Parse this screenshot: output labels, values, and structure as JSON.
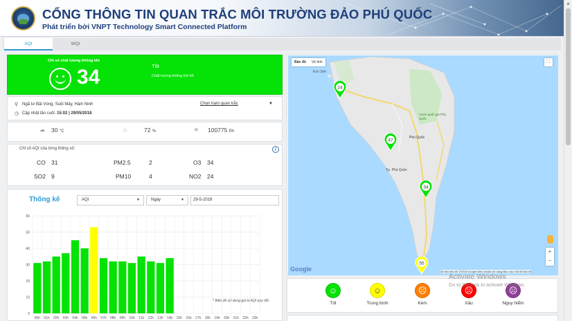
{
  "header": {
    "title": "CỔNG THÔNG TIN QUAN TRẮC MÔI TRƯỜNG ĐẢO PHÚ QUỐC",
    "subtitle": "Phát triển bởi VNPT Technology Smart Connected Platform"
  },
  "tabs": [
    {
      "label": "AQI"
    },
    {
      "label": "WQI"
    }
  ],
  "aqi": {
    "label": "Chỉ số chất lượng không khí",
    "value": "34",
    "status": "Tốt",
    "description": "Chất lượng không khí tốt",
    "color": "#05e205"
  },
  "location": {
    "address": "Ngã tư Bãi Vòng, Suối Mây, Hàm Ninh",
    "updated_label": "Cập nhật lần cuối:",
    "updated_value": "15:02 | 29/05/2018",
    "select_station": "Chọn trạm quan trắc"
  },
  "weather": {
    "temperature": "30",
    "temperature_unit": "°C",
    "humidity": "72",
    "humidity_unit": "%",
    "pressure": "100775",
    "pressure_unit": "PA"
  },
  "components": {
    "title": "Chỉ số AQI của từng thông số:",
    "items": [
      {
        "name": "CO",
        "value": "31"
      },
      {
        "name": "PM2.5",
        "value": "2"
      },
      {
        "name": "O3",
        "value": "34"
      },
      {
        "name": "SO2",
        "value": "9"
      },
      {
        "name": "PM10",
        "value": "4"
      },
      {
        "name": "NO2",
        "value": "24"
      }
    ]
  },
  "stats": {
    "title": "Thống kê",
    "type_select": "AQI",
    "period_select": "Ngày",
    "date_value": "29-5-2018",
    "note": "* Biểu đồ sử dụng giá trị AQI quy đổi"
  },
  "chart_data": {
    "type": "bar",
    "categories": [
      "00h",
      "01h",
      "02h",
      "03h",
      "04h",
      "05h",
      "06h",
      "07h",
      "08h",
      "09h",
      "10h",
      "11h",
      "12h",
      "13h",
      "14h",
      "15h",
      "16h",
      "17h",
      "18h",
      "19h",
      "20h",
      "21h",
      "22h",
      "23h"
    ],
    "values": [
      31,
      32,
      35,
      37,
      45,
      40,
      53,
      34,
      32,
      32,
      31,
      35,
      32,
      31,
      34,
      null,
      null,
      null,
      null,
      null,
      null,
      null,
      null,
      null
    ],
    "highlight": {
      "06h": "#ffff00"
    },
    "bar_color": "#05e205",
    "ylim": [
      0,
      60
    ],
    "yticks": [
      0,
      10,
      20,
      30,
      40,
      50,
      60
    ],
    "grid": true
  },
  "map": {
    "map_button": "Bản đồ",
    "satellite_button": "Vệ tinh",
    "labels": {
      "ganh_dau": "Kon Seh",
      "vuon_quoc_gia": "Vườn quốc gia Phú Quốc",
      "phu_quoc": "Phú Quốc",
      "tp_phu_quoc": "Tp. Phú Quốc"
    },
    "markers": [
      {
        "value": "24",
        "color": "#05e205"
      },
      {
        "value": "47",
        "color": "#05e205"
      },
      {
        "value": "34",
        "color": "#05e205"
      },
      {
        "value": "55",
        "color": "#ffff00"
      }
    ],
    "google": "Google",
    "footer": "Dữ liệu bản đồ ©2018 Google   Điều khoản sử dụng   Báo cáo một lỗi bản đồ"
  },
  "legend": [
    {
      "label": "Tốt",
      "color": "#05e205",
      "icon": "smile-icon"
    },
    {
      "label": "Trung bình",
      "color": "#ffff00",
      "icon": "neutral-icon"
    },
    {
      "label": "Kém",
      "color": "#ff7e00",
      "icon": "sad-icon"
    },
    {
      "label": "Xấu",
      "color": "#ff0000",
      "icon": "mask-icon"
    },
    {
      "label": "Nguy hiểm",
      "color": "#8f3f97",
      "icon": "danger-icon"
    }
  ],
  "watermark": {
    "line1": "Activate Windows",
    "line2": "Go to Settings to activate Windows."
  }
}
